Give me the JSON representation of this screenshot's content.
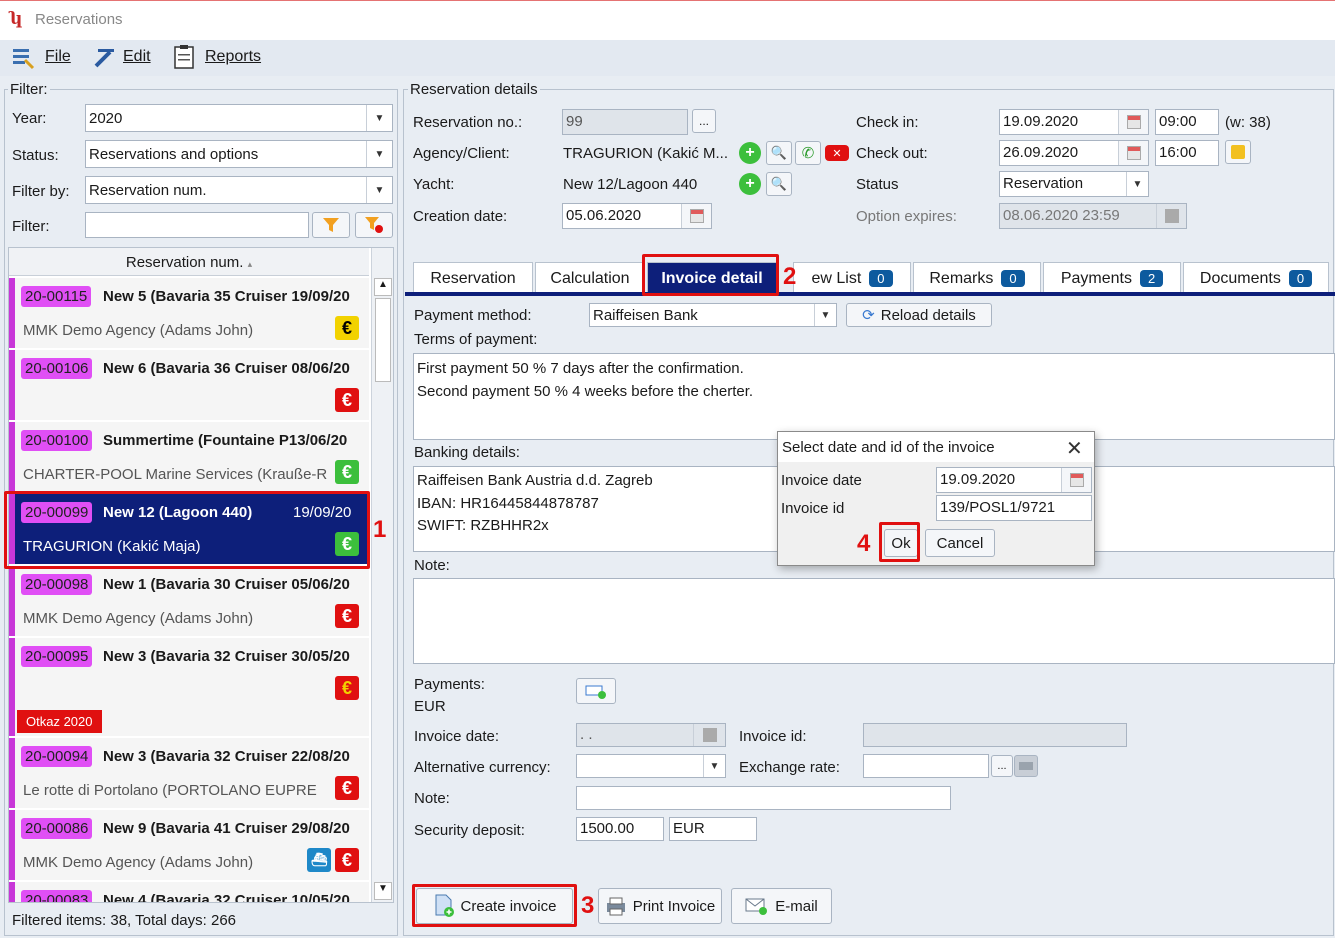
{
  "window": {
    "title": "Reservations"
  },
  "menu": {
    "file": "File",
    "edit": "Edit",
    "reports": "Reports"
  },
  "filter": {
    "legend": "Filter:",
    "year_label": "Year:",
    "year_value": "2020",
    "status_label": "Status:",
    "status_value": "Reservations and options",
    "filterby_label": "Filter by:",
    "filterby_value": "Reservation num.",
    "filter_label": "Filter:",
    "filter_value": ""
  },
  "list": {
    "header": "Reservation num.",
    "items": [
      {
        "num": "20-00115",
        "yacht": "New 5 (Bavaria 35 Cruiser 19/09/20",
        "agency": "MMK Demo Agency (Adams John)",
        "currency_color": "#f2d200",
        "text_color": "#000"
      },
      {
        "num": "20-00106",
        "yacht": "New 6 (Bavaria 36 Cruiser 08/06/20",
        "agency": "",
        "currency_color": "#e01010",
        "text_color": "#fff"
      },
      {
        "num": "20-00100",
        "yacht": "Summertime (Fountaine P13/06/20",
        "agency": "CHARTER-POOL Marine Services (Krauße-R",
        "currency_color": "#3cbf3c",
        "text_color": "#fff"
      },
      {
        "num": "20-00099",
        "yacht": "New 12 (Lagoon 440)",
        "date": "19/09/20",
        "agency": "TRAGURION (Kakić Maja)",
        "currency_color": "#3cbf3c",
        "text_color": "#fff"
      },
      {
        "num": "20-00098",
        "yacht": "New 1 (Bavaria 30 Cruiser 05/06/20",
        "agency": "MMK Demo Agency (Adams John)",
        "currency_color": "#e01010",
        "text_color": "#fff"
      },
      {
        "num": "20-00095",
        "yacht": "New 3 (Bavaria 32 Cruiser 30/05/20",
        "agency": "",
        "currency_color": "#e01010",
        "text_color": "#f2d200",
        "tag": "Otkaz 2020"
      },
      {
        "num": "20-00094",
        "yacht": "New 3 (Bavaria 32 Cruiser 22/08/20",
        "agency": "Le rotte di Portolano (PORTOLANO EUPRE",
        "currency_color": "#e01010",
        "text_color": "#fff"
      },
      {
        "num": "20-00086",
        "yacht": "New 9 (Bavaria 41 Cruiser 29/08/20",
        "agency": "MMK Demo Agency (Adams John)",
        "currency_color": "#e01010",
        "text_color": "#fff"
      },
      {
        "num": "20-00083",
        "yacht": "New 4 (Bavaria 32 Cruiser 10/05/20",
        "agency": "",
        "currency_color": "#e01010",
        "text_color": "#fff"
      }
    ],
    "currency_symbol": "€",
    "footer": "Filtered items:  38,  Total days: 266"
  },
  "details": {
    "legend": "Reservation details",
    "resno_label": "Reservation no.:",
    "resno_value": "99",
    "more": "...",
    "agency_label": "Agency/Client:",
    "agency_value": "TRAGURION (Kakić M...",
    "yacht_label": "Yacht:",
    "yacht_value": "New 12/Lagoon 440",
    "created_label": "Creation date:",
    "created_value": "05.06.2020",
    "checkin_label": "Check in:",
    "checkin_date": "19.09.2020",
    "checkin_time": "09:00",
    "week": "(w: 38)",
    "checkout_label": "Check out:",
    "checkout_date": "26.09.2020",
    "checkout_time": "16:00",
    "status_label": "Status",
    "status_value": "Reservation",
    "option_label": "Option expires:",
    "option_value": "08.06.2020 23:59"
  },
  "tabs": [
    {
      "label": "Reservation"
    },
    {
      "label": "Calculation"
    },
    {
      "label": "Invoice detail"
    },
    {
      "label": "ew List",
      "count": "0"
    },
    {
      "label": "Remarks",
      "count": "0"
    },
    {
      "label": "Payments",
      "count": "2"
    },
    {
      "label": "Documents",
      "count": "0"
    }
  ],
  "invoice": {
    "pm_label": "Payment method:",
    "pm_value": "Raiffeisen Bank",
    "reload": "Reload details",
    "terms_label": "Terms of payment:",
    "terms_l1": "First payment 50 % 7 days after the confirmation.",
    "terms_l2": "Second payment 50 % 4 weeks before the cherter.",
    "bank_label": "Banking details:",
    "bank_l1": "Raiffeisen Bank Austria d.d. Zagreb",
    "bank_l2": "IBAN: HR16445844878787",
    "bank_l3": "SWIFT: RZBHHR2x",
    "note_label": "Note:",
    "payments_label": "Payments:",
    "payments_cur": "EUR",
    "invdate_label": "Invoice date:",
    "invdate_value": " .  .",
    "invid_label": "Invoice id:",
    "altcur_label": "Alternative currency:",
    "exrate_label": "Exchange rate:",
    "note2_label": "Note:",
    "deposit_label": "Security deposit:",
    "deposit_value": "1500.00",
    "deposit_cur": "EUR",
    "create": "Create invoice",
    "print": "Print Invoice",
    "email": "E-mail"
  },
  "dialog": {
    "title": "Select date and id of the invoice",
    "date_label": "Invoice date",
    "date_value": "19.09.2020",
    "id_label": "Invoice id",
    "id_value": "139/POSL1/9721",
    "ok": "Ok",
    "cancel": "Cancel"
  },
  "annotations": {
    "n1": "1",
    "n2": "2",
    "n3": "3",
    "n4": "4"
  }
}
